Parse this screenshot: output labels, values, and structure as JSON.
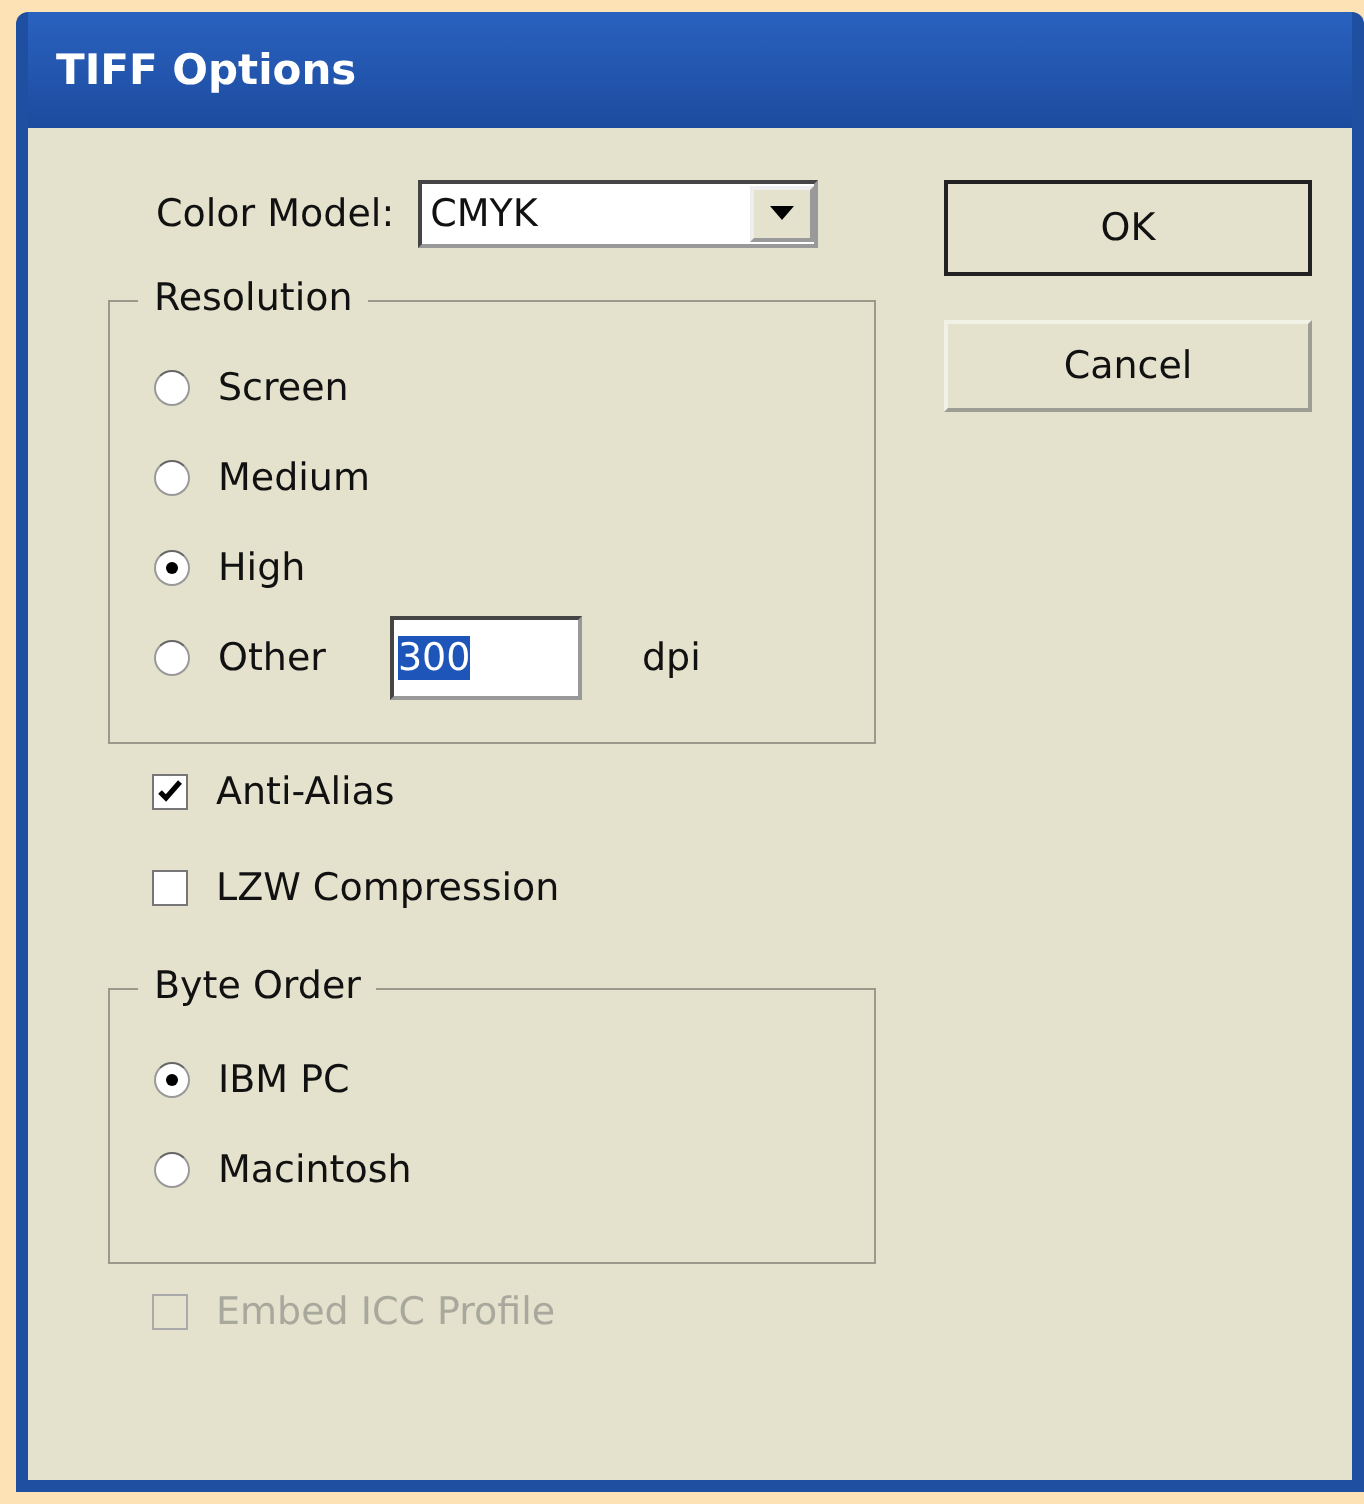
{
  "window": {
    "title": "TIFF Options"
  },
  "color_model": {
    "label": "Color Model:",
    "value": "CMYK"
  },
  "buttons": [
    {
      "label": "OK",
      "default": true
    },
    {
      "label": "Cancel",
      "default": false
    }
  ],
  "resolution": {
    "title": "Resolution",
    "options": [
      {
        "label": "Screen",
        "selected": false
      },
      {
        "label": "Medium",
        "selected": false
      },
      {
        "label": "High",
        "selected": true
      },
      {
        "label": "Other",
        "selected": false
      }
    ],
    "other_value": "300",
    "unit": "dpi"
  },
  "checkboxes": [
    {
      "label": "Anti-Alias",
      "checked": true,
      "disabled": false
    },
    {
      "label": "LZW Compression",
      "checked": false,
      "disabled": false
    }
  ],
  "byte_order": {
    "title": "Byte Order",
    "options": [
      {
        "label": "IBM PC",
        "selected": true
      },
      {
        "label": "Macintosh",
        "selected": false
      }
    ]
  },
  "embed": {
    "label": "Embed ICC Profile",
    "checked": false,
    "disabled": true
  }
}
